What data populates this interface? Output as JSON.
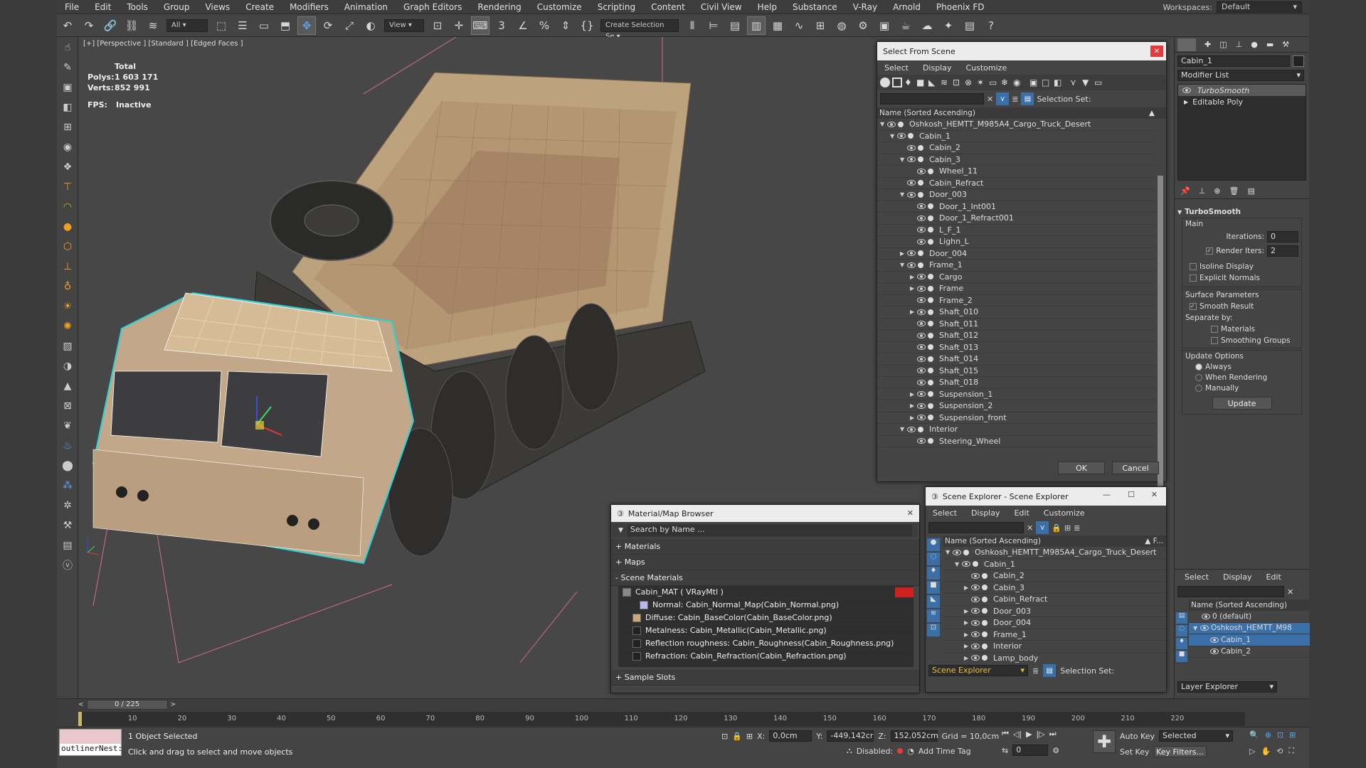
{
  "menu": [
    "File",
    "Edit",
    "Tools",
    "Group",
    "Views",
    "Create",
    "Modifiers",
    "Animation",
    "Graph Editors",
    "Rendering",
    "Customize",
    "Scripting",
    "Content",
    "Civil View",
    "Help",
    "Substance",
    "V-Ray",
    "Arnold",
    "Phoenix FD"
  ],
  "workspace": {
    "label": "Workspaces:",
    "value": "Default"
  },
  "toolbar": {
    "filter": "All",
    "view": "View",
    "selection_set": "Create Selection Se"
  },
  "viewport": {
    "label": "[+] [Perspective ] [Standard ] [Edged Faces ]",
    "stats_total": "Total",
    "polys_label": "Polys:",
    "polys": "1 603 171",
    "verts_label": "Verts:",
    "verts": "852 991",
    "fps_label": "FPS:",
    "fps": "Inactive"
  },
  "command_panel": {
    "name": "Cabin_1",
    "modifier_list": "Modifier List",
    "stack": [
      "TurboSmooth",
      "Editable Poly"
    ],
    "rollout": "TurboSmooth",
    "main": "Main",
    "iterations_label": "Iterations:",
    "iterations": "0",
    "render_iters_label": "Render Iters:",
    "render_iters": "2",
    "isoline": "Isoline Display",
    "explicit": "Explicit Normals",
    "surface": "Surface Parameters",
    "smooth": "Smooth Result",
    "separate": "Separate by:",
    "materials": "Materials",
    "smoothing": "Smoothing Groups",
    "update_options": "Update Options",
    "always": "Always",
    "when_rendering": "When Rendering",
    "manually": "Manually",
    "update_btn": "Update"
  },
  "select_dialog": {
    "title": "Select From Scene",
    "menu": [
      "Select",
      "Display",
      "Customize"
    ],
    "selection_set": "Selection Set:",
    "header": "Name (Sorted Ascending)",
    "ok": "OK",
    "cancel": "Cancel",
    "rows": [
      {
        "label": "Oshkosh_HEMTT_M985A4_Cargo_Truck_Desert",
        "level": 0,
        "toggle": "▼"
      },
      {
        "label": "Cabin_1",
        "level": 1,
        "toggle": "▼"
      },
      {
        "label": "Cabin_2",
        "level": 2,
        "toggle": ""
      },
      {
        "label": "Cabin_3",
        "level": 2,
        "toggle": "▼"
      },
      {
        "label": "Wheel_11",
        "level": 3,
        "toggle": ""
      },
      {
        "label": "Cabin_Refract",
        "level": 2,
        "toggle": ""
      },
      {
        "label": "Door_003",
        "level": 2,
        "toggle": "▼"
      },
      {
        "label": "Door_1_Int001",
        "level": 3,
        "toggle": ""
      },
      {
        "label": "Door_1_Refract001",
        "level": 3,
        "toggle": ""
      },
      {
        "label": "L_F_1",
        "level": 3,
        "toggle": ""
      },
      {
        "label": "Lighn_L",
        "level": 3,
        "toggle": ""
      },
      {
        "label": "Door_004",
        "level": 2,
        "toggle": "▶"
      },
      {
        "label": "Frame_1",
        "level": 2,
        "toggle": "▼"
      },
      {
        "label": "Cargo",
        "level": 3,
        "toggle": "▶"
      },
      {
        "label": "Frame",
        "level": 3,
        "toggle": "▶"
      },
      {
        "label": "Frame_2",
        "level": 3,
        "toggle": ""
      },
      {
        "label": "Shaft_010",
        "level": 3,
        "toggle": "▶"
      },
      {
        "label": "Shaft_011",
        "level": 3,
        "toggle": ""
      },
      {
        "label": "Shaft_012",
        "level": 3,
        "toggle": ""
      },
      {
        "label": "Shaft_013",
        "level": 3,
        "toggle": ""
      },
      {
        "label": "Shaft_014",
        "level": 3,
        "toggle": ""
      },
      {
        "label": "Shaft_015",
        "level": 3,
        "toggle": ""
      },
      {
        "label": "Shaft_018",
        "level": 3,
        "toggle": ""
      },
      {
        "label": "Suspension_1",
        "level": 3,
        "toggle": "▶"
      },
      {
        "label": "Suspension_2",
        "level": 3,
        "toggle": "▶"
      },
      {
        "label": "Suspension_front",
        "level": 3,
        "toggle": "▶"
      },
      {
        "label": "Interior",
        "level": 2,
        "toggle": "▼"
      },
      {
        "label": "Steering_Wheel",
        "level": 3,
        "toggle": ""
      }
    ]
  },
  "material_browser": {
    "title": "Material/Map Browser",
    "search": "Search by Name ...",
    "materials": "+ Materials",
    "maps": "+ Maps",
    "scene_materials": "- Scene Materials",
    "items": [
      "Cabin_MAT ( VRayMtl )",
      "Normal: Cabin_Normal_Map(Cabin_Normal.png)",
      "Diffuse: Cabin_BaseColor(Cabin_BaseColor.png)",
      "Metalness: Cabin_Metallic(Cabin_Metallic.png)",
      "Reflection roughness: Cabin_Roughness(Cabin_Roughness.png)",
      "Refraction: Cabin_Refraction(Cabin_Refraction.png)"
    ],
    "sample_slots": "+ Sample Slots"
  },
  "scene_explorer": {
    "title": "Scene Explorer - Scene Explorer",
    "menu": [
      "Select",
      "Display",
      "Edit",
      "Customize"
    ],
    "header": "Name (Sorted Ascending)",
    "header2": "F...",
    "footer_name": "Scene Explorer",
    "selection_set": "Selection Set:",
    "rows": [
      {
        "label": "Oshkosh_HEMTT_M985A4_Cargo_Truck_Desert",
        "level": 0,
        "toggle": "▼"
      },
      {
        "label": "Cabin_1",
        "level": 1,
        "toggle": "▼"
      },
      {
        "label": "Cabin_2",
        "level": 2,
        "toggle": ""
      },
      {
        "label": "Cabin_3",
        "level": 2,
        "toggle": "▶"
      },
      {
        "label": "Cabin_Refract",
        "level": 2,
        "toggle": ""
      },
      {
        "label": "Door_003",
        "level": 2,
        "toggle": "▶"
      },
      {
        "label": "Door_004",
        "level": 2,
        "toggle": "▶"
      },
      {
        "label": "Frame_1",
        "level": 2,
        "toggle": "▶"
      },
      {
        "label": "Interior",
        "level": 2,
        "toggle": "▶"
      },
      {
        "label": "Lamp_body",
        "level": 2,
        "toggle": "▶"
      }
    ]
  },
  "layer_explorer": {
    "menu": [
      "Select",
      "Display",
      "Edit"
    ],
    "header": "Name (Sorted Ascending)",
    "rows": [
      "0 (default)",
      "Oshkosh_HEMTT_M98",
      "Cabin_1",
      "Cabin_2"
    ],
    "footer": "Layer Explorer"
  },
  "timeline": {
    "frame": "0 / 225",
    "ticks": [
      "10",
      "20",
      "30",
      "40",
      "50",
      "60",
      "70",
      "80",
      "90",
      "100",
      "110",
      "120",
      "130",
      "140",
      "150",
      "160",
      "170",
      "180",
      "190",
      "200",
      "210",
      "220"
    ]
  },
  "status": {
    "script": "outlinerNest:",
    "selected": "1 Object Selected",
    "hint": "Click and drag to select and move objects",
    "x_label": "X:",
    "x": "0,0cm",
    "y_label": "Y:",
    "y": "-449,142cr",
    "z_label": "Z:",
    "z": "152,052cm",
    "grid": "Grid = 10,0cm",
    "disabled": "Disabled:",
    "add_time_tag": "Add Time Tag",
    "auto_key": "Auto Key",
    "set_key": "Set Key",
    "selected_dd": "Selected",
    "key_filters": "Key Filters...",
    "frame": "0"
  }
}
